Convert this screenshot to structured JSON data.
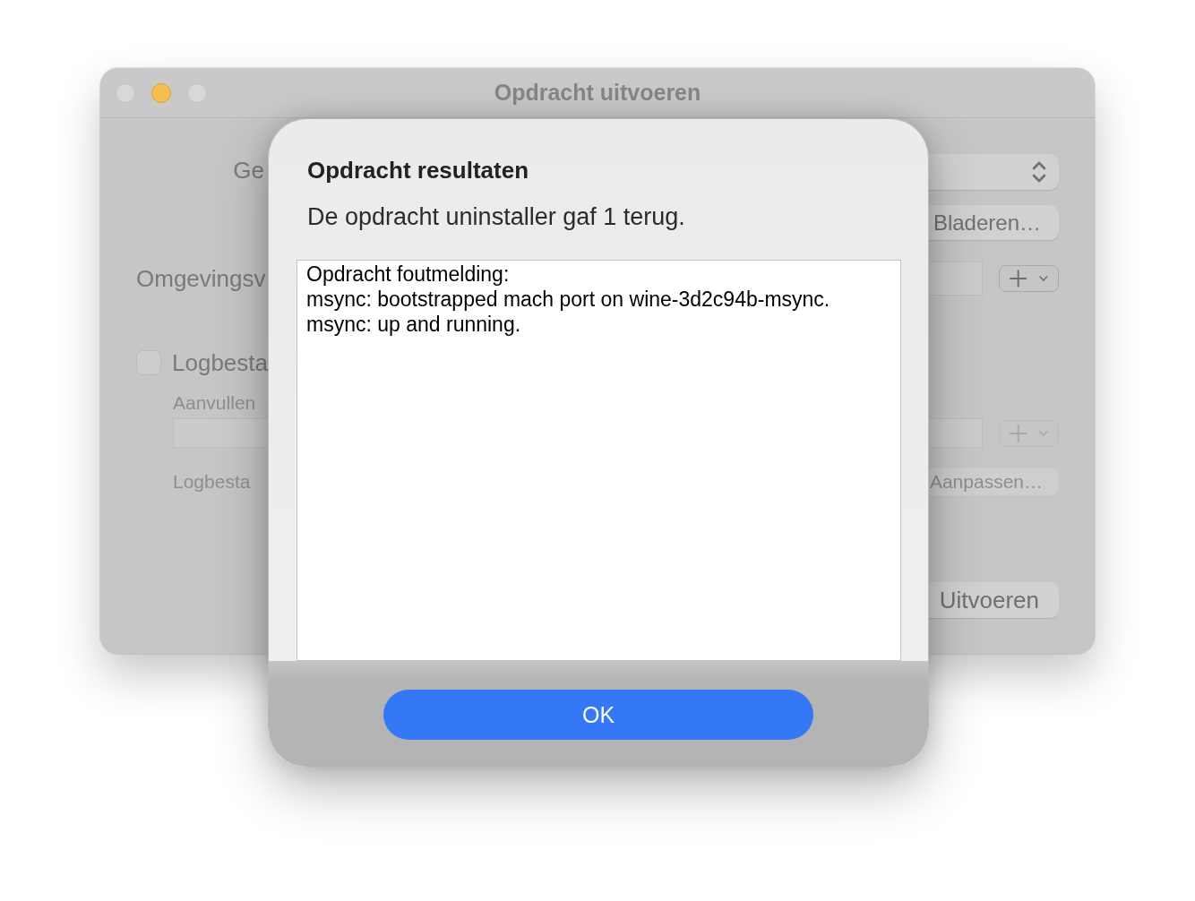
{
  "window": {
    "title": "Opdracht uitvoeren",
    "controls": [
      {
        "kind": "close",
        "active": false
      },
      {
        "kind": "minimize",
        "active": true
      },
      {
        "kind": "zoom",
        "active": false
      }
    ]
  },
  "form": {
    "label_1": "Ge",
    "browse_button": {
      "label": "Bladeren…"
    },
    "label_2": "Omgevingsv",
    "add_buttons": [
      {
        "disabled": false
      },
      {
        "disabled": true
      }
    ],
    "log_checkbox": {
      "label": "Logbesta",
      "checked": false
    },
    "label_3": {
      "text": "Aanvullen",
      "disabled": true
    },
    "label_4": {
      "text": "Logbesta",
      "disabled": true
    },
    "customize_button": {
      "label": "Aanpassen…",
      "disabled": true
    },
    "run_button": {
      "label": "Uitvoeren"
    }
  },
  "dialog": {
    "title": "Opdracht resultaten",
    "message": "De opdracht uninstaller gaf 1 terug.",
    "output": [
      "Opdracht foutmelding:",
      "msync: bootstrapped mach port on wine-3d2c94b-msync.",
      "msync: up and running."
    ],
    "buttons": [
      {
        "label": "OK",
        "default": true
      }
    ]
  }
}
